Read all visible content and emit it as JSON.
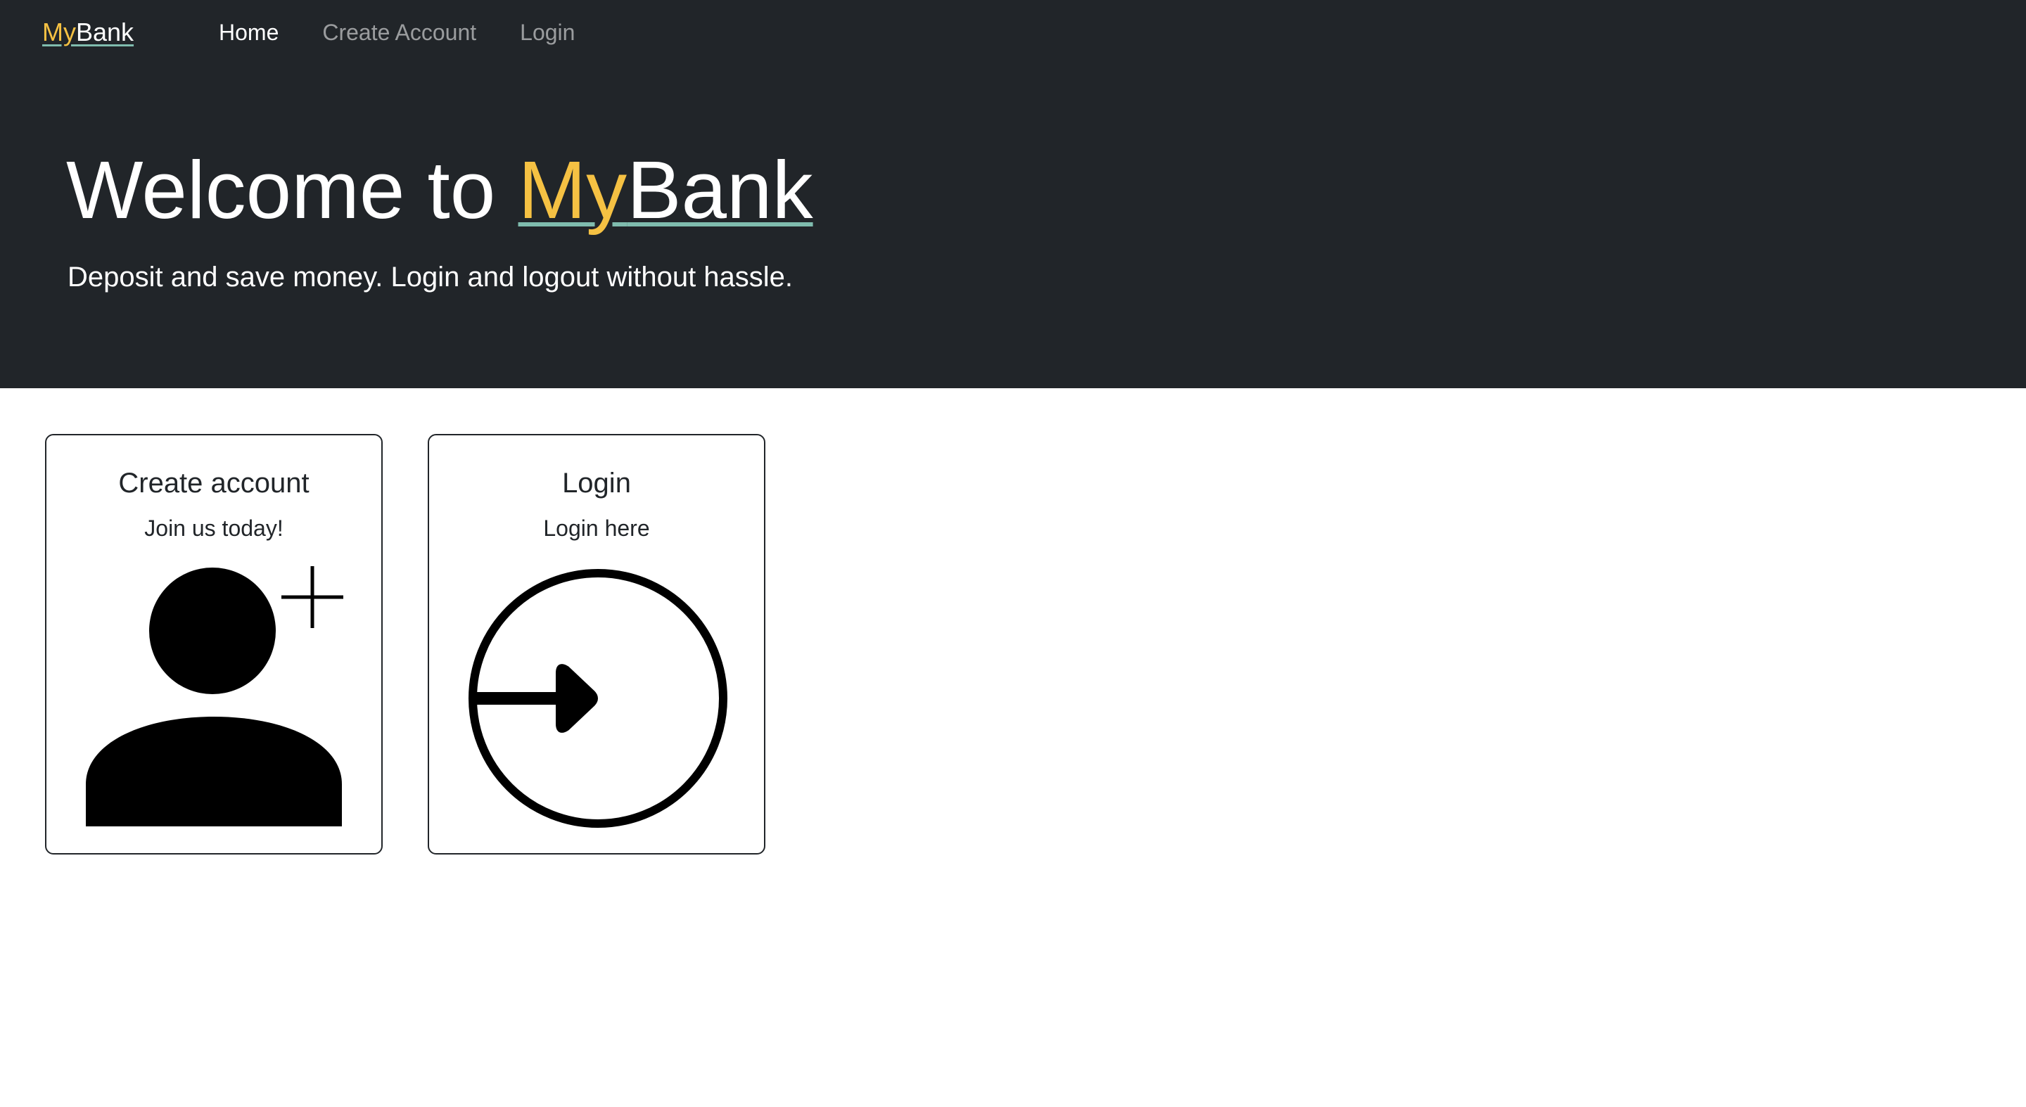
{
  "navbar": {
    "brand": {
      "part1": "My",
      "part2": "Bank"
    },
    "links": [
      {
        "label": "Home",
        "active": true
      },
      {
        "label": "Create Account",
        "active": false
      },
      {
        "label": "Login",
        "active": false
      }
    ]
  },
  "hero": {
    "title_prefix": "Welcome to ",
    "brand": {
      "part1": "My",
      "part2": "Bank"
    },
    "subtitle": "Deposit and save money. Login and logout without hassle."
  },
  "cards": [
    {
      "title": "Create account",
      "text": "Join us today!",
      "icon": "person-add-icon"
    },
    {
      "title": "Login",
      "text": "Login here",
      "icon": "box-arrow-in-right-icon"
    }
  ],
  "colors": {
    "dark_background": "#212529",
    "brand_accent_yellow": "#f5c143",
    "brand_underline_teal": "#7fbcae",
    "nav_inactive": "rgba(255,255,255,0.55)"
  }
}
